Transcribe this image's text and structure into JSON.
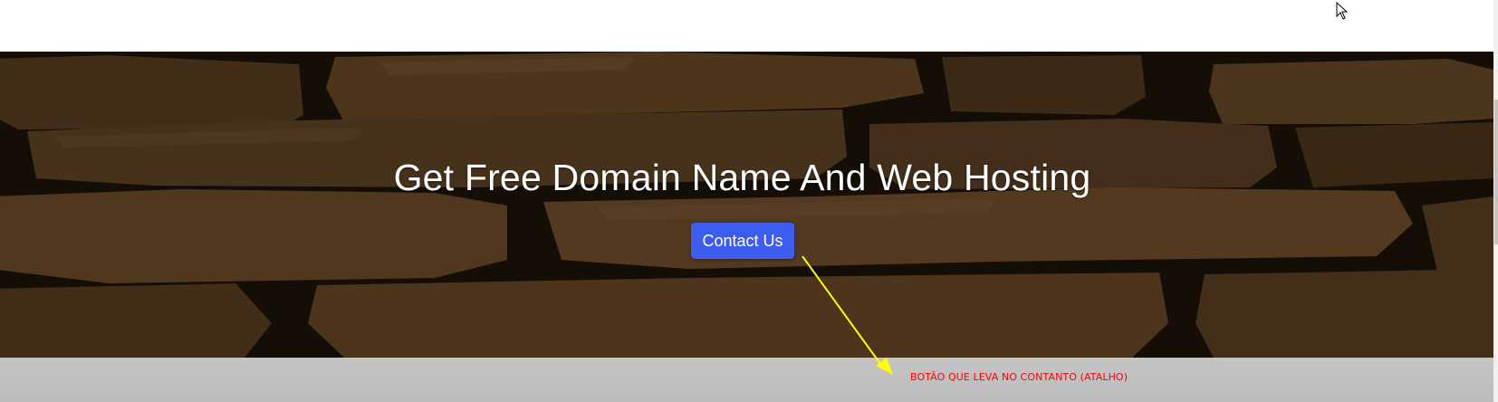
{
  "hero": {
    "title": "Get Free Domain Name And Web Hosting",
    "button_label": "Contact Us"
  },
  "annotation": {
    "text": "BOTÃO QUE LEVA NO CONTANTO (ATALHO)",
    "arrow_color": "#ffff00",
    "text_color": "#ff0000"
  },
  "colors": {
    "button": "#3d5cf0",
    "hero_background": "#2a1d10",
    "band": "#c4c4c4"
  },
  "icons": {
    "cursor": "mouse-pointer-icon"
  }
}
